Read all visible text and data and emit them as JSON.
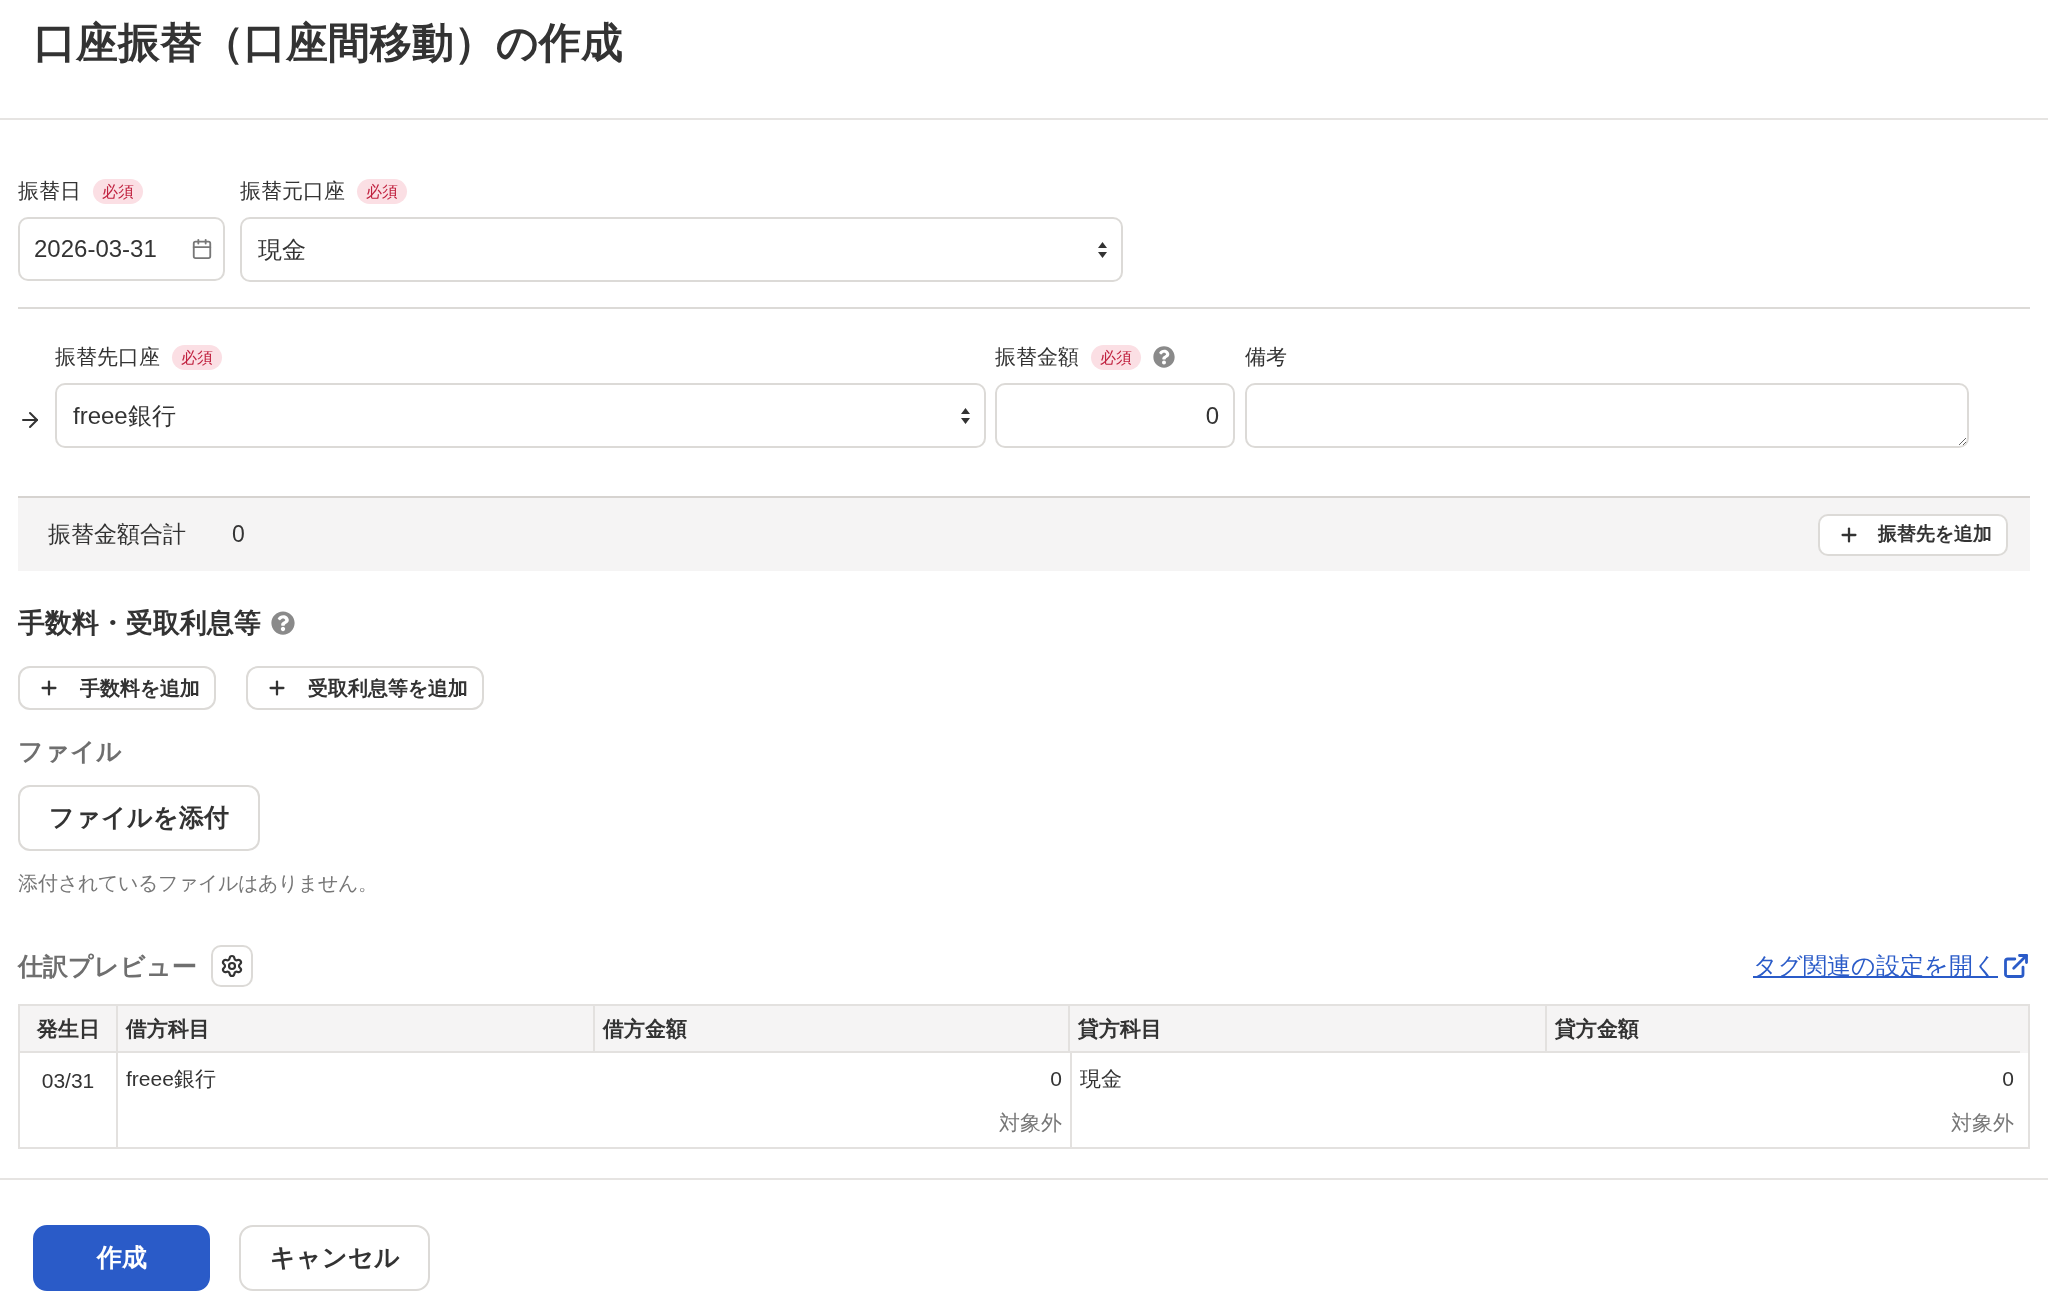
{
  "title": "口座振替（口座間移動）の作成",
  "source": {
    "date": {
      "label": "振替日",
      "badge": "必須",
      "value": "2026-03-31"
    },
    "account": {
      "label": "振替元口座",
      "badge": "必須",
      "value": "現金"
    }
  },
  "destinations": [
    {
      "account": {
        "label": "振替先口座",
        "badge": "必須",
        "value": "freee銀行"
      },
      "amount": {
        "label": "振替金額",
        "badge": "必須",
        "value": "0"
      },
      "memo": {
        "label": "備考"
      }
    }
  ],
  "summary": {
    "label": "振替金額合計",
    "value": "0",
    "add_button": "振替先を追加"
  },
  "fees": {
    "heading": "手数料・受取利息等",
    "buttons": [
      "手数料を追加",
      "受取利息等を追加"
    ]
  },
  "file": {
    "heading": "ファイル",
    "button": "ファイルを添付",
    "empty_message": "添付されているファイルはありません。"
  },
  "preview": {
    "heading": "仕訳プレビュー",
    "settings_link": "タグ関連の設定を開く",
    "columns": [
      "発生日",
      "借方科目",
      "借方金額",
      "貸方科目",
      "貸方金額"
    ],
    "rows": [
      {
        "date": "03/31",
        "debit_account": "freee銀行",
        "debit_amount": "0",
        "debit_tax": "対象外",
        "credit_account": "現金",
        "credit_amount": "0",
        "credit_tax": "対象外"
      }
    ]
  },
  "actions": [
    {
      "label": "作成",
      "kind": "primary"
    },
    {
      "label": "キャンセル",
      "kind": "secondary"
    }
  ]
}
